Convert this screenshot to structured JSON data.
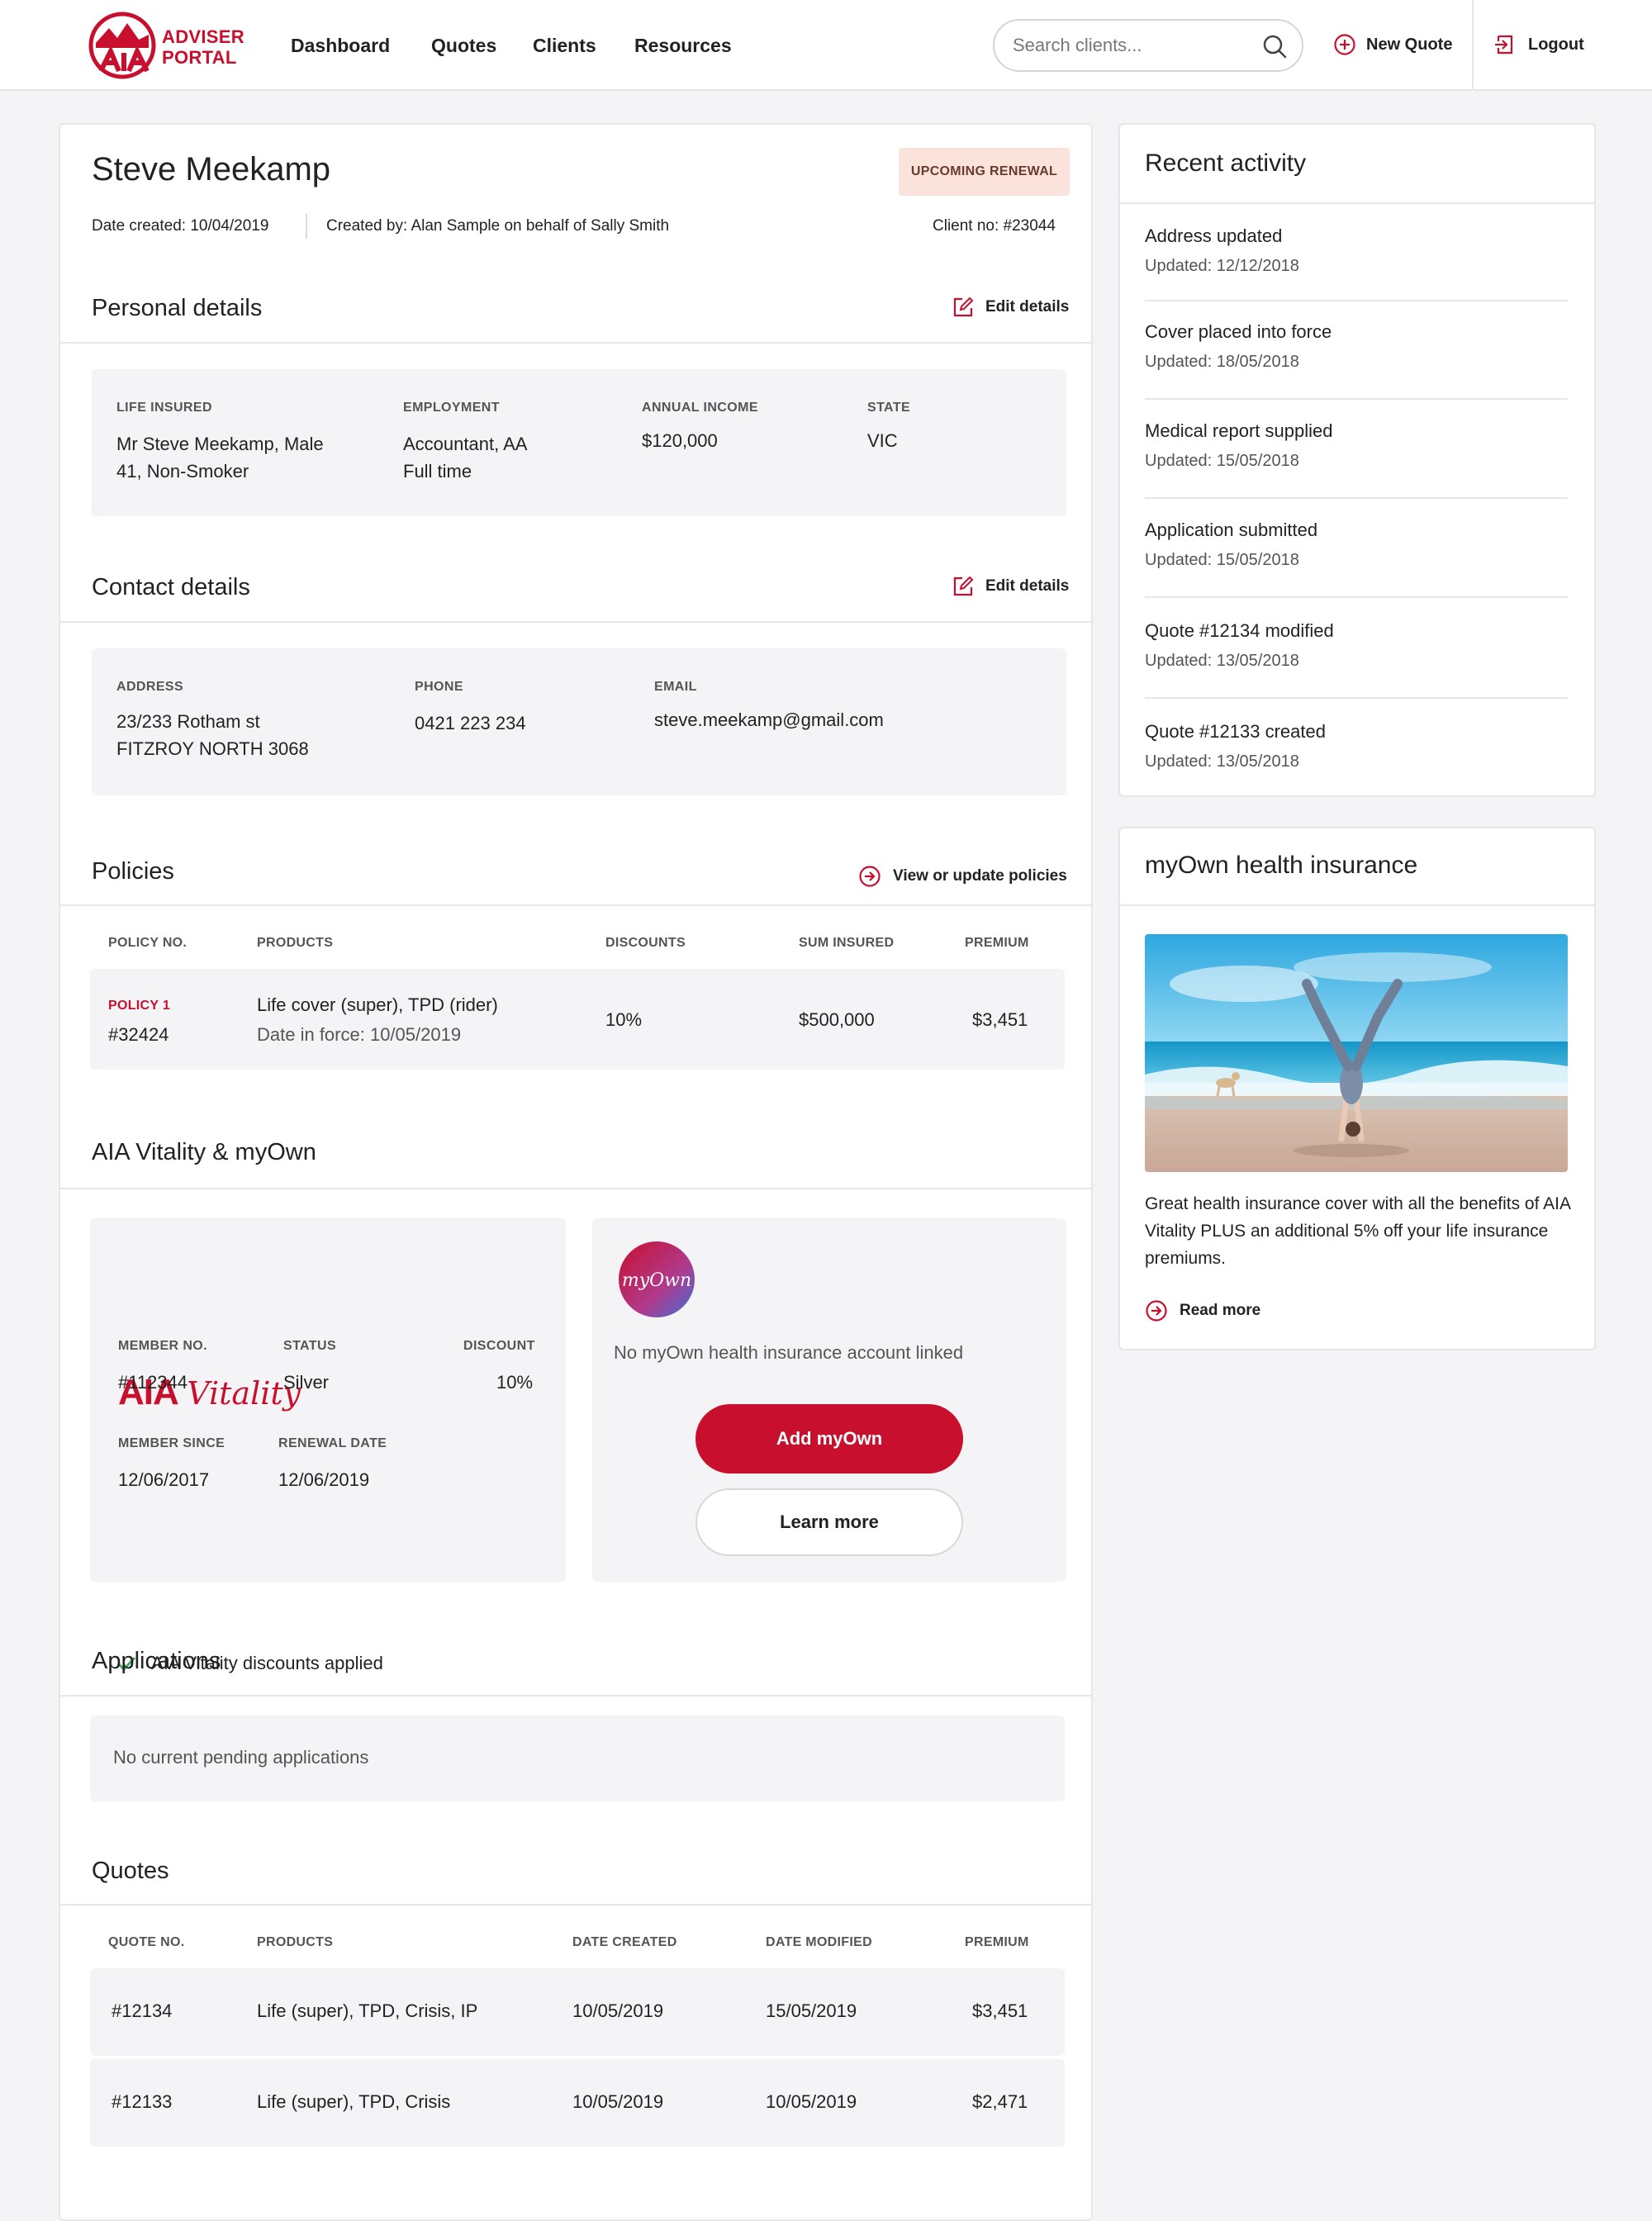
{
  "brand": {
    "line1": "ADVISER",
    "line2": "PORTAL",
    "accent": "#c8102e"
  },
  "nav": {
    "dashboard": "Dashboard",
    "quotes": "Quotes",
    "clients": "Clients",
    "resources": "Resources"
  },
  "search": {
    "placeholder": "Search clients..."
  },
  "header_actions": {
    "new_quote": "New Quote",
    "logout": "Logout"
  },
  "client": {
    "name": "Steve Meekamp",
    "badge": "UPCOMING RENEWAL",
    "date_created": "Date created: 10/04/2019",
    "created_by": "Created by: Alan Sample on behalf of Sally Smith",
    "client_no": "Client no: #23044"
  },
  "personal": {
    "title": "Personal details",
    "edit": "Edit details",
    "life_insured_label": "LIFE INSURED",
    "life_insured_line1": "Mr Steve Meekamp, Male",
    "life_insured_line2": "41, Non-Smoker",
    "employment_label": "EMPLOYMENT",
    "employment_line1": "Accountant, AA",
    "employment_line2": "Full time",
    "income_label": "ANNUAL INCOME",
    "income": "$120,000",
    "state_label": "STATE",
    "state": "VIC"
  },
  "contact": {
    "title": "Contact details",
    "edit": "Edit details",
    "address_label": "ADDRESS",
    "address_line1": "23/233 Rotham st",
    "address_line2": "FITZROY NORTH 3068",
    "phone_label": "PHONE",
    "phone": "0421 223 234",
    "email_label": "EMAIL",
    "email": "steve.meekamp@gmail.com"
  },
  "policies": {
    "title": "Policies",
    "link": "View or update policies",
    "headers": [
      "POLICY NO.",
      "PRODUCTS",
      "DISCOUNTS",
      "SUM INSURED",
      "PREMIUM"
    ],
    "rows": [
      {
        "tag": "POLICY 1",
        "number": "#32424",
        "products": "Life cover (super), TPD (rider)",
        "in_force": "Date in force: 10/05/2019",
        "discount": "10%",
        "sum_insured": "$500,000",
        "premium": "$3,451"
      }
    ]
  },
  "vitality": {
    "title": "AIA Vitality & myOwn",
    "logo_aia": "AIA",
    "logo_script": "Vitality",
    "member_no_label": "MEMBER NO.",
    "member_no": "#112344",
    "status_label": "STATUS",
    "status": "Silver",
    "discount_label": "DISCOUNT",
    "discount": "10%",
    "member_since_label": "MEMBER SINCE",
    "member_since": "12/06/2017",
    "renewal_label": "RENEWAL DATE",
    "renewal": "12/06/2019",
    "applied": "AIA Vitality discounts applied",
    "myown_badge": "myOwn",
    "myown_status": "No myOwn health insurance account linked",
    "add_button": "Add myOwn",
    "learn_button": "Learn more"
  },
  "applications": {
    "title": "Applications",
    "empty": "No current pending applications"
  },
  "quotes": {
    "title": "Quotes",
    "headers": [
      "QUOTE NO.",
      "PRODUCTS",
      "DATE CREATED",
      "DATE MODIFIED",
      "PREMIUM"
    ],
    "rows": [
      {
        "number": "#12134",
        "products": "Life (super), TPD, Crisis, IP",
        "created": "10/05/2019",
        "modified": "15/05/2019",
        "premium": "$3,451"
      },
      {
        "number": "#12133",
        "products": "Life (super), TPD, Crisis",
        "created": "10/05/2019",
        "modified": "10/05/2019",
        "premium": "$2,471"
      }
    ]
  },
  "activity": {
    "title": "Recent activity",
    "items": [
      {
        "title": "Address updated",
        "date": "Updated: 12/12/2018"
      },
      {
        "title": "Cover placed into force",
        "date": "Updated: 18/05/2018"
      },
      {
        "title": "Medical report supplied",
        "date": "Updated: 15/05/2018"
      },
      {
        "title": "Application submitted",
        "date": "Updated: 15/05/2018"
      },
      {
        "title": "Quote #12134 modified",
        "date": "Updated: 13/05/2018"
      },
      {
        "title": "Quote #12133 created",
        "date": "Updated: 13/05/2018"
      }
    ]
  },
  "promo": {
    "title": "myOwn health insurance",
    "text": "Great health insurance cover with all the benefits of AIA Vitality PLUS an additional 5% off your life insurance premiums.",
    "link": "Read more"
  }
}
